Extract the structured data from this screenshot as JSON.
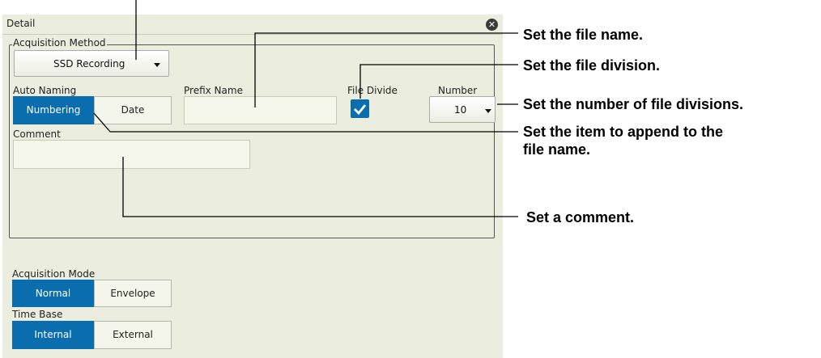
{
  "dialog": {
    "title": "Detail",
    "close_icon": "close-icon"
  },
  "acquisition_method": {
    "legend": "Acquisition Method",
    "value": "SSD Recording"
  },
  "auto_naming": {
    "label": "Auto Naming",
    "options": [
      "Numbering",
      "Date"
    ],
    "selected": "Numbering"
  },
  "prefix_name": {
    "label": "Prefix Name",
    "value": ""
  },
  "file_divide": {
    "label": "File Divide",
    "checked": true
  },
  "number": {
    "label": "Number",
    "value": "10"
  },
  "comment": {
    "label": "Comment",
    "value": ""
  },
  "acquisition_mode": {
    "label": "Acquisition Mode",
    "options": [
      "Normal",
      "Envelope"
    ],
    "selected": "Normal"
  },
  "time_base": {
    "label": "Time Base",
    "options": [
      "Internal",
      "External"
    ],
    "selected": "Internal"
  },
  "annotations": {
    "file_name": "Set the file name.",
    "file_division": "Set the file division.",
    "num_divisions": "Set the number of file divisions.",
    "append_item_1": "Set the item to append to the",
    "append_item_2": "file name.",
    "comment": "Set a comment."
  },
  "colors": {
    "panel_bg": "#ebeedf",
    "selected_blue": "#0a6dad"
  }
}
